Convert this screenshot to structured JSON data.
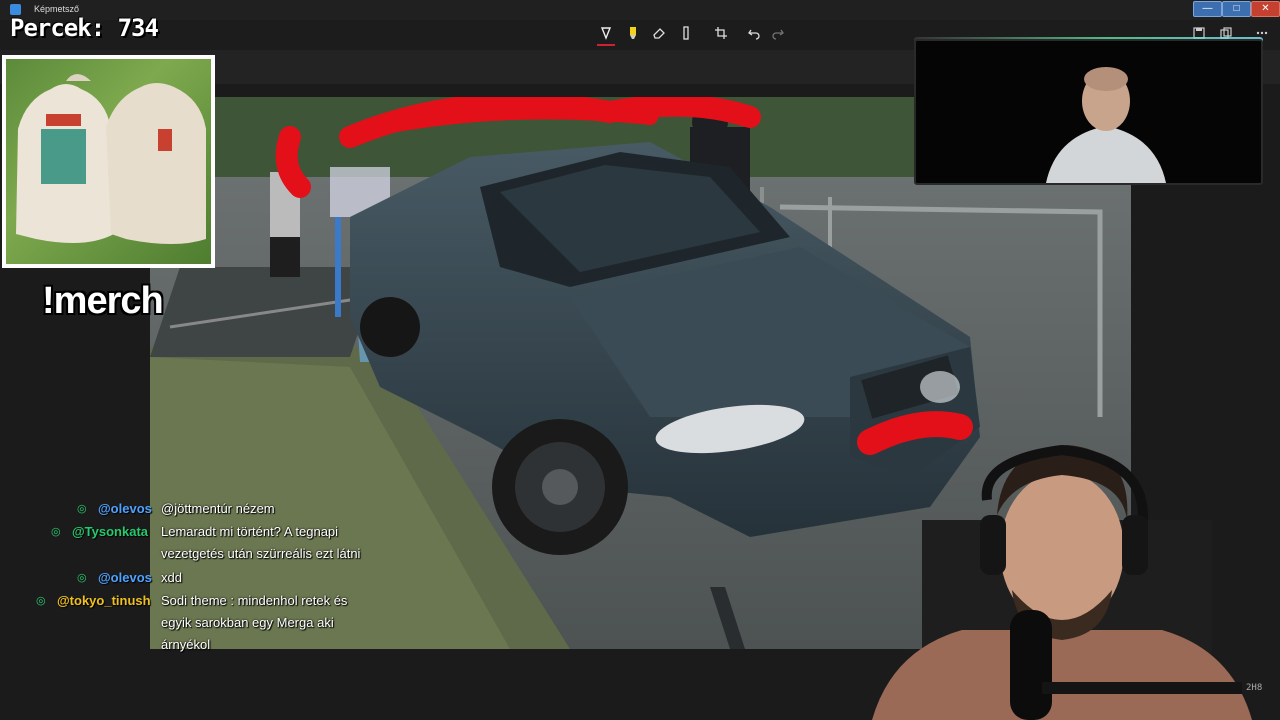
{
  "window": {
    "title": "Képmetsző",
    "minimize_label": "—",
    "maximize_label": "□",
    "close_label": "✕"
  },
  "overlay": {
    "counter_label": "Percek:",
    "counter_value": "734",
    "merch_command": "!merch",
    "cam_badge": "2H8"
  },
  "toolbar": {
    "tools": [
      "ballpoint-pen",
      "highlighter",
      "eraser",
      "ruler",
      "crop",
      "undo",
      "redo"
    ],
    "right_tools": [
      "save",
      "copy",
      "more"
    ]
  },
  "colors": {
    "accent_green": "#27c96c",
    "user_blue": "#4ea2ff",
    "redaction_red": "#e3101a",
    "close_red": "#c64030"
  },
  "chat": {
    "messages": [
      {
        "user": "@olevos",
        "color": "#4ea2ff",
        "text": "@jöttmentúr nézem"
      },
      {
        "user": "@Tysonkata",
        "color": "#27c96c",
        "text": "Lemaradt mi történt? A tegnapi"
      },
      {
        "user": "",
        "color": "",
        "text": "vezetgetés után szürreális ezt látni"
      },
      {
        "user": "@olevos",
        "color": "#4ea2ff",
        "text": "xdd"
      },
      {
        "user": "@tokyo_tinush",
        "color": "#f0c020",
        "text": "Sodi theme : mindenhol retek és"
      },
      {
        "user": "",
        "color": "",
        "text": "egyik sarokban egy Merga aki"
      },
      {
        "user": "",
        "color": "",
        "text": "árnyékol"
      }
    ]
  }
}
